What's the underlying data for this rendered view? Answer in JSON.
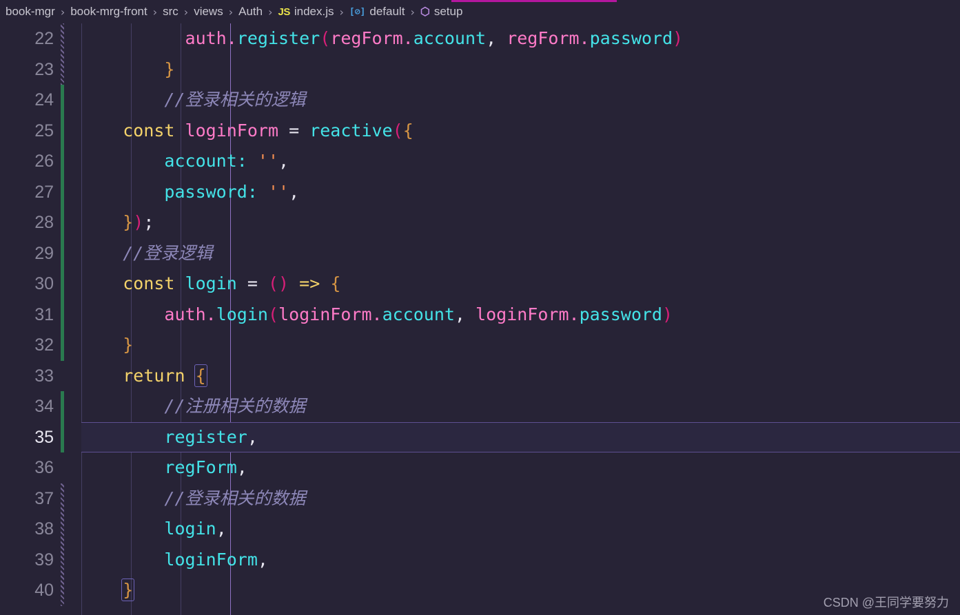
{
  "window": {
    "background_color": "#272336",
    "progress_bar_color": "#b3179e"
  },
  "breadcrumb": {
    "separator": "›",
    "items": [
      {
        "label": "book-mgr",
        "icon": ""
      },
      {
        "label": "book-mrg-front",
        "icon": ""
      },
      {
        "label": "src",
        "icon": ""
      },
      {
        "label": "views",
        "icon": ""
      },
      {
        "label": "Auth",
        "icon": ""
      },
      {
        "label": "index.js",
        "icon": "js-file-icon",
        "icon_glyph": "JS"
      },
      {
        "label": "default",
        "icon": "module-export-icon",
        "icon_glyph": "[⊘]"
      },
      {
        "label": "setup",
        "icon": "method-cube-icon",
        "icon_glyph": "⬡"
      }
    ]
  },
  "editor": {
    "active_line": 35,
    "first_visible_line": 22,
    "last_visible_line": 40,
    "colors": {
      "keyword": "#f3d26a",
      "variable": "#ff7bc8",
      "function": "#44e3e8",
      "paren": "#d81f78",
      "brace": "#d69544",
      "string": "#f58f52",
      "comment": "#8d87b8",
      "operator": "#e7e5ef",
      "line_number": "#8a879a",
      "line_number_active": "#e8e6f0",
      "gutter_added": "#2a7a4f",
      "gutter_modified": "#6f628f",
      "indent_guide": "#453f63",
      "indent_guide_active": "#8f72c4"
    },
    "lines": [
      {
        "number": 22,
        "gutter": "modified",
        "tokens": [
          {
            "t": "          ",
            "c": "t-punct"
          },
          {
            "t": "auth",
            "c": "t-var"
          },
          {
            "t": ".",
            "c": "t-dot"
          },
          {
            "t": "register",
            "c": "t-fn"
          },
          {
            "t": "(",
            "c": "t-paren"
          },
          {
            "t": "regForm",
            "c": "t-var"
          },
          {
            "t": ".",
            "c": "t-dot"
          },
          {
            "t": "account",
            "c": "t-prop"
          },
          {
            "t": ",",
            "c": "t-punct"
          },
          {
            "t": " ",
            "c": "t-punct"
          },
          {
            "t": "regForm",
            "c": "t-var"
          },
          {
            "t": ".",
            "c": "t-dot"
          },
          {
            "t": "password",
            "c": "t-prop"
          },
          {
            "t": ")",
            "c": "t-paren"
          }
        ]
      },
      {
        "number": 23,
        "gutter": "modified",
        "tokens": [
          {
            "t": "        ",
            "c": "t-punct"
          },
          {
            "t": "}",
            "c": "t-brace"
          }
        ]
      },
      {
        "number": 24,
        "gutter": "added",
        "tokens": [
          {
            "t": "        ",
            "c": "t-punct"
          },
          {
            "t": "//登录相关的逻辑",
            "c": "t-comment"
          }
        ]
      },
      {
        "number": 25,
        "gutter": "added",
        "tokens": [
          {
            "t": "    ",
            "c": "t-punct"
          },
          {
            "t": "const",
            "c": "t-kw"
          },
          {
            "t": " ",
            "c": "t-punct"
          },
          {
            "t": "loginForm",
            "c": "t-var"
          },
          {
            "t": " ",
            "c": "t-punct"
          },
          {
            "t": "=",
            "c": "t-op"
          },
          {
            "t": " ",
            "c": "t-punct"
          },
          {
            "t": "reactive",
            "c": "t-fn"
          },
          {
            "t": "(",
            "c": "t-paren"
          },
          {
            "t": "{",
            "c": "t-brace"
          }
        ]
      },
      {
        "number": 26,
        "gutter": "added",
        "tokens": [
          {
            "t": "        ",
            "c": "t-punct"
          },
          {
            "t": "account",
            "c": "t-prop"
          },
          {
            "t": ":",
            "c": "t-prop"
          },
          {
            "t": " ",
            "c": "t-punct"
          },
          {
            "t": "''",
            "c": "t-str"
          },
          {
            "t": ",",
            "c": "t-punct"
          }
        ]
      },
      {
        "number": 27,
        "gutter": "added",
        "tokens": [
          {
            "t": "        ",
            "c": "t-punct"
          },
          {
            "t": "password",
            "c": "t-prop"
          },
          {
            "t": ":",
            "c": "t-prop"
          },
          {
            "t": " ",
            "c": "t-punct"
          },
          {
            "t": "''",
            "c": "t-str"
          },
          {
            "t": ",",
            "c": "t-punct"
          }
        ]
      },
      {
        "number": 28,
        "gutter": "added",
        "tokens": [
          {
            "t": "    ",
            "c": "t-punct"
          },
          {
            "t": "}",
            "c": "t-brace"
          },
          {
            "t": ")",
            "c": "t-paren"
          },
          {
            "t": ";",
            "c": "t-op"
          }
        ]
      },
      {
        "number": 29,
        "gutter": "added",
        "tokens": [
          {
            "t": "    ",
            "c": "t-punct"
          },
          {
            "t": "//登录逻辑",
            "c": "t-comment"
          }
        ]
      },
      {
        "number": 30,
        "gutter": "added",
        "tokens": [
          {
            "t": "    ",
            "c": "t-punct"
          },
          {
            "t": "const",
            "c": "t-kw"
          },
          {
            "t": " ",
            "c": "t-punct"
          },
          {
            "t": "login",
            "c": "t-fn"
          },
          {
            "t": " ",
            "c": "t-punct"
          },
          {
            "t": "=",
            "c": "t-op"
          },
          {
            "t": " ",
            "c": "t-punct"
          },
          {
            "t": "()",
            "c": "t-paren"
          },
          {
            "t": " ",
            "c": "t-punct"
          },
          {
            "t": "=>",
            "c": "t-arrow"
          },
          {
            "t": " ",
            "c": "t-punct"
          },
          {
            "t": "{",
            "c": "t-brace"
          }
        ]
      },
      {
        "number": 31,
        "gutter": "added",
        "tokens": [
          {
            "t": "        ",
            "c": "t-punct"
          },
          {
            "t": "auth",
            "c": "t-var"
          },
          {
            "t": ".",
            "c": "t-dot"
          },
          {
            "t": "login",
            "c": "t-fn"
          },
          {
            "t": "(",
            "c": "t-paren"
          },
          {
            "t": "loginForm",
            "c": "t-var"
          },
          {
            "t": ".",
            "c": "t-dot"
          },
          {
            "t": "account",
            "c": "t-prop"
          },
          {
            "t": ",",
            "c": "t-punct"
          },
          {
            "t": " ",
            "c": "t-punct"
          },
          {
            "t": "loginForm",
            "c": "t-var"
          },
          {
            "t": ".",
            "c": "t-dot"
          },
          {
            "t": "password",
            "c": "t-prop"
          },
          {
            "t": ")",
            "c": "t-paren"
          }
        ]
      },
      {
        "number": 32,
        "gutter": "added",
        "tokens": [
          {
            "t": "    ",
            "c": "t-punct"
          },
          {
            "t": "}",
            "c": "t-brace"
          }
        ]
      },
      {
        "number": 33,
        "gutter": "none",
        "tokens": [
          {
            "t": "    ",
            "c": "t-punct"
          },
          {
            "t": "return",
            "c": "t-kw"
          },
          {
            "t": " ",
            "c": "t-punct"
          },
          {
            "t": "{",
            "c": "t-brace bracket-match"
          }
        ]
      },
      {
        "number": 34,
        "gutter": "added",
        "tokens": [
          {
            "t": "        ",
            "c": "t-punct"
          },
          {
            "t": "//注册相关的数据",
            "c": "t-comment"
          }
        ]
      },
      {
        "number": 35,
        "gutter": "added",
        "tokens": [
          {
            "t": "        ",
            "c": "t-punct"
          },
          {
            "t": "register",
            "c": "t-ident"
          },
          {
            "t": ",",
            "c": "t-punct"
          }
        ]
      },
      {
        "number": 36,
        "gutter": "none",
        "tokens": [
          {
            "t": "        ",
            "c": "t-punct"
          },
          {
            "t": "regForm",
            "c": "t-ident"
          },
          {
            "t": ",",
            "c": "t-punct"
          }
        ]
      },
      {
        "number": 37,
        "gutter": "modified",
        "tokens": [
          {
            "t": "        ",
            "c": "t-punct"
          },
          {
            "t": "//登录相关的数据",
            "c": "t-comment"
          }
        ]
      },
      {
        "number": 38,
        "gutter": "modified",
        "tokens": [
          {
            "t": "        ",
            "c": "t-punct"
          },
          {
            "t": "login",
            "c": "t-ident"
          },
          {
            "t": ",",
            "c": "t-punct"
          }
        ]
      },
      {
        "number": 39,
        "gutter": "modified",
        "tokens": [
          {
            "t": "        ",
            "c": "t-punct"
          },
          {
            "t": "loginForm",
            "c": "t-ident"
          },
          {
            "t": ",",
            "c": "t-punct"
          }
        ]
      },
      {
        "number": 40,
        "gutter": "modified",
        "tokens": [
          {
            "t": "    ",
            "c": "t-punct"
          },
          {
            "t": "}",
            "c": "t-brace bracket-match"
          }
        ]
      }
    ]
  },
  "watermark": {
    "text": "CSDN @王同学要努力"
  }
}
